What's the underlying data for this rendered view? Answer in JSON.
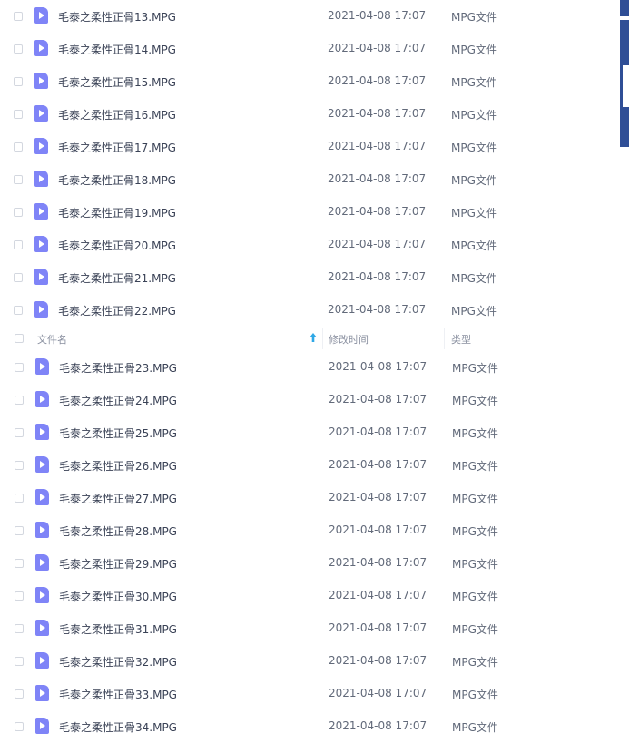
{
  "header": {
    "name_label": "文件名",
    "date_label": "修改时间",
    "type_label": "类型",
    "sort_icon": "arrow-up-icon"
  },
  "file_icon": "video-file-icon",
  "rows_top": [
    {
      "name": "毛泰之柔性正骨13.MPG",
      "date": "2021-04-08 17:07",
      "type": "MPG文件"
    },
    {
      "name": "毛泰之柔性正骨14.MPG",
      "date": "2021-04-08 17:07",
      "type": "MPG文件"
    },
    {
      "name": "毛泰之柔性正骨15.MPG",
      "date": "2021-04-08 17:07",
      "type": "MPG文件"
    },
    {
      "name": "毛泰之柔性正骨16.MPG",
      "date": "2021-04-08 17:07",
      "type": "MPG文件"
    },
    {
      "name": "毛泰之柔性正骨17.MPG",
      "date": "2021-04-08 17:07",
      "type": "MPG文件"
    },
    {
      "name": "毛泰之柔性正骨18.MPG",
      "date": "2021-04-08 17:07",
      "type": "MPG文件"
    },
    {
      "name": "毛泰之柔性正骨19.MPG",
      "date": "2021-04-08 17:07",
      "type": "MPG文件"
    },
    {
      "name": "毛泰之柔性正骨20.MPG",
      "date": "2021-04-08 17:07",
      "type": "MPG文件"
    },
    {
      "name": "毛泰之柔性正骨21.MPG",
      "date": "2021-04-08 17:07",
      "type": "MPG文件"
    },
    {
      "name": "毛泰之柔性正骨22.MPG",
      "date": "2021-04-08 17:07",
      "type": "MPG文件"
    }
  ],
  "rows_bottom": [
    {
      "name": "毛泰之柔性正骨23.MPG",
      "date": "2021-04-08 17:07",
      "type": "MPG文件"
    },
    {
      "name": "毛泰之柔性正骨24.MPG",
      "date": "2021-04-08 17:07",
      "type": "MPG文件"
    },
    {
      "name": "毛泰之柔性正骨25.MPG",
      "date": "2021-04-08 17:07",
      "type": "MPG文件"
    },
    {
      "name": "毛泰之柔性正骨26.MPG",
      "date": "2021-04-08 17:07",
      "type": "MPG文件"
    },
    {
      "name": "毛泰之柔性正骨27.MPG",
      "date": "2021-04-08 17:07",
      "type": "MPG文件"
    },
    {
      "name": "毛泰之柔性正骨28.MPG",
      "date": "2021-04-08 17:07",
      "type": "MPG文件"
    },
    {
      "name": "毛泰之柔性正骨29.MPG",
      "date": "2021-04-08 17:07",
      "type": "MPG文件"
    },
    {
      "name": "毛泰之柔性正骨30.MPG",
      "date": "2021-04-08 17:07",
      "type": "MPG文件"
    },
    {
      "name": "毛泰之柔性正骨31.MPG",
      "date": "2021-04-08 17:07",
      "type": "MPG文件"
    },
    {
      "name": "毛泰之柔性正骨32.MPG",
      "date": "2021-04-08 17:07",
      "type": "MPG文件"
    },
    {
      "name": "毛泰之柔性正骨33.MPG",
      "date": "2021-04-08 17:07",
      "type": "MPG文件"
    },
    {
      "name": "毛泰之柔性正骨34.MPG",
      "date": "2021-04-08 17:07",
      "type": "MPG文件"
    }
  ],
  "colors": {
    "accent": "#2f4e96",
    "file_icon": "#7f84f7",
    "sort_arrow": "#2fa8e6"
  }
}
